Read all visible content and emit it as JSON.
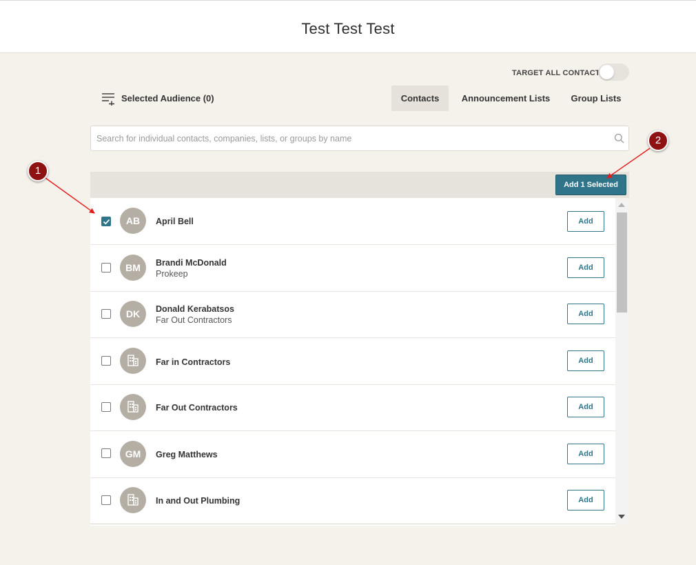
{
  "header": {
    "title": "Test Test Test"
  },
  "target_all": {
    "label": "TARGET ALL CONTACTS",
    "enabled": false
  },
  "audience": {
    "label": "Selected Audience (0)",
    "icon": "playlist-add-icon"
  },
  "tabs": [
    {
      "label": "Contacts",
      "active": true
    },
    {
      "label": "Announcement Lists",
      "active": false
    },
    {
      "label": "Group Lists",
      "active": false
    }
  ],
  "search": {
    "placeholder": "Search for individual contacts, companies, lists, or groups by name",
    "value": ""
  },
  "bulk_action": {
    "label": "Add 1 Selected"
  },
  "add_label": "Add",
  "rows": [
    {
      "initials": "AB",
      "name": "April Bell",
      "subtitle": "",
      "checked": true,
      "type": "person"
    },
    {
      "initials": "BM",
      "name": "Brandi McDonald",
      "subtitle": "Prokeep",
      "checked": false,
      "type": "person"
    },
    {
      "initials": "DK",
      "name": "Donald Kerabatsos",
      "subtitle": "Far Out Contractors",
      "checked": false,
      "type": "person"
    },
    {
      "initials": "",
      "name": "Far in Contractors",
      "subtitle": "",
      "checked": false,
      "type": "company"
    },
    {
      "initials": "",
      "name": "Far Out Contractors",
      "subtitle": "",
      "checked": false,
      "type": "company"
    },
    {
      "initials": "GM",
      "name": "Greg Matthews",
      "subtitle": "",
      "checked": false,
      "type": "person"
    },
    {
      "initials": "",
      "name": "In and Out Plumbing",
      "subtitle": "",
      "checked": false,
      "type": "company"
    }
  ],
  "callouts": [
    {
      "label": "1"
    },
    {
      "label": "2"
    }
  ],
  "colors": {
    "accent": "#2f7489",
    "callout": "#8e1212",
    "avatar": "#b4aea5",
    "background": "#f5f1eb"
  }
}
